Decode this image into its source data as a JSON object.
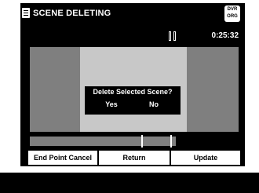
{
  "header": {
    "title": "SCENE DELETING",
    "icon": "scene-list-icon",
    "badge": [
      "DVR",
      "ORG"
    ]
  },
  "playback": {
    "state_icon": "pause-icon",
    "time": "0:25:32",
    "timeline_progress": 0.7
  },
  "dialog": {
    "question": "Delete Selected Scene?",
    "yes_label": "Yes",
    "no_label": "No"
  },
  "buttons": {
    "end_point_cancel": "End Point Cancel",
    "return": "Return",
    "update": "Update"
  },
  "colors": {
    "panel": "#000000",
    "gray": "#7f7f7f",
    "dialog_frame": "#c8c8c8",
    "text": "#ffffff"
  }
}
